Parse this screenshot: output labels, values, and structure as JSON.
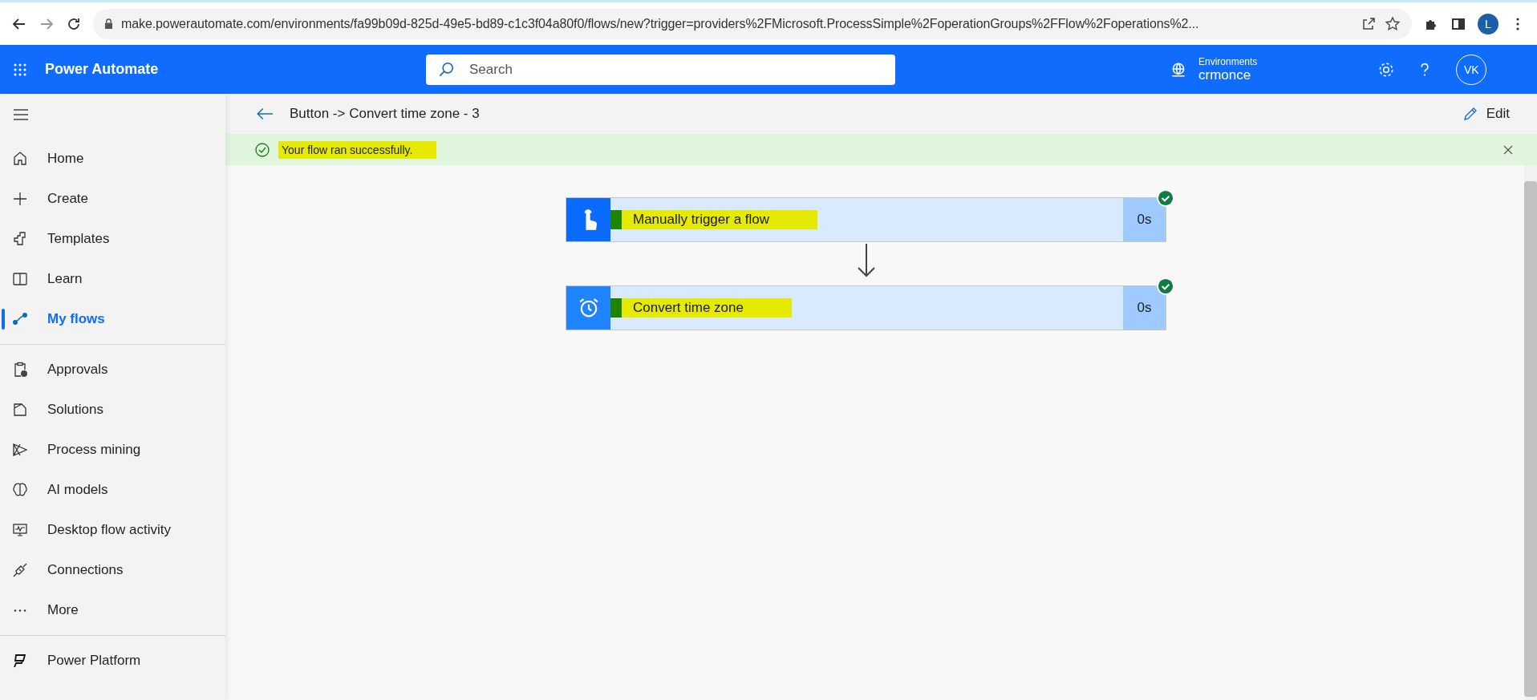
{
  "browser": {
    "url": "make.powerautomate.com/environments/fa99b09d-825d-49e5-bd89-c1c3f04a80f0/flows/new?trigger=providers%2FMicrosoft.ProcessSimple%2FoperationGroups%2FFlow%2Foperations%2...",
    "profile_initial": "L"
  },
  "header": {
    "app_title": "Power Automate",
    "search": {
      "placeholder": "Search"
    },
    "environment_label": "Environments",
    "environment_name": "crmonce",
    "avatar_initials": "VK"
  },
  "sidebar": {
    "groups": [
      [
        {
          "label": "Home",
          "selected": false
        },
        {
          "label": "Create",
          "selected": false
        },
        {
          "label": "Templates",
          "selected": false
        },
        {
          "label": "Learn",
          "selected": false
        },
        {
          "label": "My flows",
          "selected": true
        }
      ],
      [
        {
          "label": "Approvals",
          "selected": false
        },
        {
          "label": "Solutions",
          "selected": false
        },
        {
          "label": "Process mining",
          "selected": false
        },
        {
          "label": "AI models",
          "selected": false
        },
        {
          "label": "Desktop flow activity",
          "selected": false
        },
        {
          "label": "Connections",
          "selected": false
        },
        {
          "label": "More",
          "selected": false
        }
      ],
      [
        {
          "label": "Power Platform",
          "selected": false
        }
      ]
    ]
  },
  "breadcrumb": {
    "title": "Button -> Convert time zone - 3",
    "edit_label": "Edit"
  },
  "banner": {
    "message": "Your flow ran successfully.",
    "highlighted": true
  },
  "flow_steps": [
    {
      "kind": "trigger",
      "title": "Manually trigger a flow",
      "duration": "0s",
      "succeeded": true,
      "highlighted": true
    },
    {
      "kind": "action",
      "title": "Convert time zone",
      "duration": "0s",
      "succeeded": true,
      "highlighted": true
    }
  ]
}
